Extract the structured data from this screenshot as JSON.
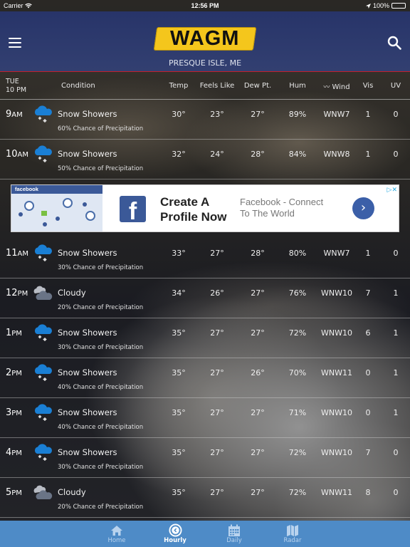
{
  "status_bar": {
    "carrier": "Carrier",
    "time": "12:56 PM",
    "battery": "100%",
    "battery_level": 1.0
  },
  "header": {
    "logo_text": "WAGM",
    "location": "PRESQUE ISLE, ME",
    "menu_icon": "hamburger-menu-icon",
    "search_icon": "search-icon"
  },
  "columns": {
    "day": "TUE",
    "time": "10 PM",
    "condition": "Condition",
    "temp": "Temp",
    "feels_like": "Feels Like",
    "dew_pt": "Dew Pt.",
    "hum": "Hum",
    "wind": "Wind",
    "vis": "Vis",
    "uv": "UV"
  },
  "hours": [
    {
      "hour": "9",
      "ampm": "AM",
      "icon": "snow-showers",
      "condition": "Snow Showers",
      "precip": "60% Chance of Precipitation",
      "temp": "30°",
      "feels": "23°",
      "dew": "27°",
      "hum": "89%",
      "wind": "WNW7",
      "vis": "1",
      "uv": "0"
    },
    {
      "hour": "10",
      "ampm": "AM",
      "icon": "snow-showers",
      "condition": "Snow Showers",
      "precip": "50% Chance of Precipitation",
      "temp": "32°",
      "feels": "24°",
      "dew": "28°",
      "hum": "84%",
      "wind": "WNW8",
      "vis": "1",
      "uv": "0"
    },
    {
      "hour": "11",
      "ampm": "AM",
      "icon": "snow-showers",
      "condition": "Snow Showers",
      "precip": "30% Chance of Precipitation",
      "temp": "33°",
      "feels": "27°",
      "dew": "28°",
      "hum": "80%",
      "wind": "WNW7",
      "vis": "1",
      "uv": "0"
    },
    {
      "hour": "12",
      "ampm": "PM",
      "icon": "cloudy",
      "condition": "Cloudy",
      "precip": "20% Chance of Precipitation",
      "temp": "34°",
      "feels": "26°",
      "dew": "27°",
      "hum": "76%",
      "wind": "WNW10",
      "vis": "7",
      "uv": "1"
    },
    {
      "hour": "1",
      "ampm": "PM",
      "icon": "snow-showers",
      "condition": "Snow Showers",
      "precip": "30% Chance of Precipitation",
      "temp": "35°",
      "feels": "27°",
      "dew": "27°",
      "hum": "72%",
      "wind": "WNW10",
      "vis": "6",
      "uv": "1"
    },
    {
      "hour": "2",
      "ampm": "PM",
      "icon": "snow-showers",
      "condition": "Snow Showers",
      "precip": "40% Chance of Precipitation",
      "temp": "35°",
      "feels": "27°",
      "dew": "26°",
      "hum": "70%",
      "wind": "WNW11",
      "vis": "0",
      "uv": "1"
    },
    {
      "hour": "3",
      "ampm": "PM",
      "icon": "snow-showers",
      "condition": "Snow Showers",
      "precip": "40% Chance of Precipitation",
      "temp": "35°",
      "feels": "27°",
      "dew": "27°",
      "hum": "71%",
      "wind": "WNW10",
      "vis": "0",
      "uv": "1"
    },
    {
      "hour": "4",
      "ampm": "PM",
      "icon": "snow-showers",
      "condition": "Snow Showers",
      "precip": "30% Chance of Precipitation",
      "temp": "35°",
      "feels": "27°",
      "dew": "27°",
      "hum": "72%",
      "wind": "WNW10",
      "vis": "7",
      "uv": "0"
    },
    {
      "hour": "5",
      "ampm": "PM",
      "icon": "cloudy",
      "condition": "Cloudy",
      "precip": "20% Chance of Precipitation",
      "temp": "35°",
      "feels": "27°",
      "dew": "27°",
      "hum": "72%",
      "wind": "WNW11",
      "vis": "8",
      "uv": "0"
    }
  ],
  "ad": {
    "brand_label": "facebook",
    "headline_line1": "Create A",
    "headline_line2": "Profile Now",
    "sub_line1": "Facebook - Connect",
    "sub_line2": "To The World",
    "cta_glyph": "›",
    "choices_glyph": "▷✕"
  },
  "tabs": [
    {
      "label": "Home",
      "icon": "home-icon",
      "active": false
    },
    {
      "label": "Hourly",
      "icon": "clock-icon",
      "active": true
    },
    {
      "label": "Daily",
      "icon": "calendar-icon",
      "active": false
    },
    {
      "label": "Radar",
      "icon": "map-icon",
      "active": false
    }
  ],
  "colors": {
    "header_bg": "#26346e",
    "header_border": "#c4202a",
    "logo_yellow": "#f4c61c",
    "snow_icon_blue": "#1a7fd4",
    "tabbar_bg": "#4e8bc7",
    "facebook_blue": "#3b5998"
  }
}
